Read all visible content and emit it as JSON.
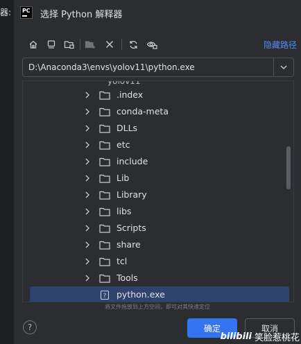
{
  "background": {
    "label": "器:"
  },
  "dialog": {
    "app_icon_text": "PC",
    "title": "选择 Python 解释器"
  },
  "toolbar": {
    "icons": [
      "home-icon",
      "desktop-icon",
      "project-folder-icon",
      "new-folder-icon",
      "delete-icon",
      "refresh-icon",
      "show-hidden-icon"
    ],
    "hide_path_label": "隐藏路径"
  },
  "path": {
    "value": "D:\\Anaconda3\\envs\\yolov11\\python.exe"
  },
  "tree": {
    "partial_item": "yolov11",
    "items": [
      {
        "label": ".index",
        "type": "folder"
      },
      {
        "label": "conda-meta",
        "type": "folder"
      },
      {
        "label": "DLLs",
        "type": "folder"
      },
      {
        "label": "etc",
        "type": "folder"
      },
      {
        "label": "include",
        "type": "folder"
      },
      {
        "label": "Lib",
        "type": "folder"
      },
      {
        "label": "Library",
        "type": "folder"
      },
      {
        "label": "libs",
        "type": "folder"
      },
      {
        "label": "Scripts",
        "type": "folder"
      },
      {
        "label": "share",
        "type": "folder"
      },
      {
        "label": "tcl",
        "type": "folder"
      },
      {
        "label": "Tools",
        "type": "folder"
      },
      {
        "label": "python.exe",
        "type": "file",
        "selected": true
      }
    ]
  },
  "hint": "将文件拖放到上方空间，即可对其快速定位",
  "buttons": {
    "help": "?",
    "ok": "确定",
    "cancel": "取消"
  },
  "watermark": {
    "logo": "bilibili",
    "text": "笑脸惹桃花"
  },
  "colors": {
    "accent": "#3574f0",
    "link": "#548af7",
    "selected_row": "#2e436e",
    "background": "#2b2d30"
  }
}
